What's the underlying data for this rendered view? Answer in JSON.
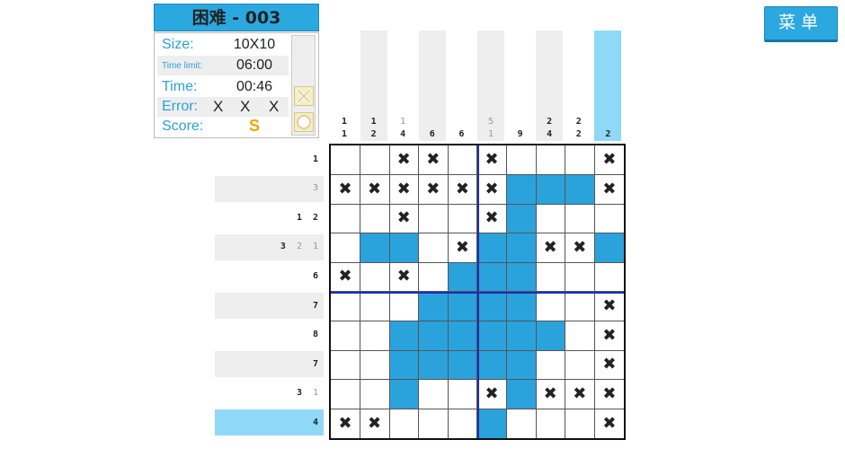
{
  "title": "困难 - 003",
  "menu_label": "菜单",
  "info": {
    "size_label": "Size:",
    "size_value": "10X10",
    "time_limit_label": "Time limit:",
    "time_limit_value": "06:00",
    "time_label": "Time:",
    "time_value": "00:46",
    "error_label": "Error:",
    "error_marks": [
      "X",
      "X",
      "X"
    ],
    "score_label": "Score:",
    "score_value": "S"
  },
  "colors": {
    "accent": "#2aa3dd",
    "score": "#f0a400",
    "highlight": "#8fd8f8",
    "divider": "#1a2fb5"
  },
  "column_clues": [
    {
      "nums": [
        {
          "v": "1",
          "done": false
        },
        {
          "v": "1",
          "done": false
        }
      ],
      "shade": false
    },
    {
      "nums": [
        {
          "v": "1",
          "done": false
        },
        {
          "v": "2",
          "done": false
        }
      ],
      "shade": true
    },
    {
      "nums": [
        {
          "v": "1",
          "done": true
        },
        {
          "v": "4",
          "done": false
        }
      ],
      "shade": false
    },
    {
      "nums": [
        {
          "v": "6",
          "done": false
        }
      ],
      "shade": true
    },
    {
      "nums": [
        {
          "v": "6",
          "done": false
        }
      ],
      "shade": false
    },
    {
      "nums": [
        {
          "v": "5",
          "done": true
        },
        {
          "v": "1",
          "done": true
        }
      ],
      "shade": true
    },
    {
      "nums": [
        {
          "v": "9",
          "done": false
        }
      ],
      "shade": false
    },
    {
      "nums": [
        {
          "v": "2",
          "done": false
        },
        {
          "v": "4",
          "done": false
        }
      ],
      "shade": true
    },
    {
      "nums": [
        {
          "v": "2",
          "done": false
        },
        {
          "v": "2",
          "done": false
        }
      ],
      "shade": false
    },
    {
      "nums": [
        {
          "v": "2",
          "done": false
        }
      ],
      "shade": "highlight"
    }
  ],
  "row_clues": [
    {
      "nums": [
        {
          "v": "1",
          "done": false
        }
      ],
      "shade": false
    },
    {
      "nums": [
        {
          "v": "3",
          "done": true
        }
      ],
      "shade": true
    },
    {
      "nums": [
        {
          "v": "1",
          "done": false
        },
        {
          "v": "2",
          "done": false
        }
      ],
      "shade": false
    },
    {
      "nums": [
        {
          "v": "3",
          "done": false
        },
        {
          "v": "2",
          "done": true
        },
        {
          "v": "1",
          "done": true
        }
      ],
      "shade": true
    },
    {
      "nums": [
        {
          "v": "6",
          "done": false
        }
      ],
      "shade": false
    },
    {
      "nums": [
        {
          "v": "7",
          "done": false
        }
      ],
      "shade": true
    },
    {
      "nums": [
        {
          "v": "8",
          "done": false
        }
      ],
      "shade": false
    },
    {
      "nums": [
        {
          "v": "7",
          "done": false
        }
      ],
      "shade": true
    },
    {
      "nums": [
        {
          "v": "3",
          "done": false
        },
        {
          "v": "1",
          "done": true
        }
      ],
      "shade": false
    },
    {
      "nums": [
        {
          "v": "4",
          "done": false
        }
      ],
      "shade": "highlight"
    }
  ],
  "grid": [
    "..xx.x...x",
    "xxxxxxfffx",
    "..x..xf...",
    ".ff.xffxxf",
    "x.x.fff...",
    "...ffff..x",
    "..ffffff.x",
    "..fffff..x",
    "..f..xfxxx",
    "xx...f...x"
  ],
  "mark_symbol": "✖"
}
